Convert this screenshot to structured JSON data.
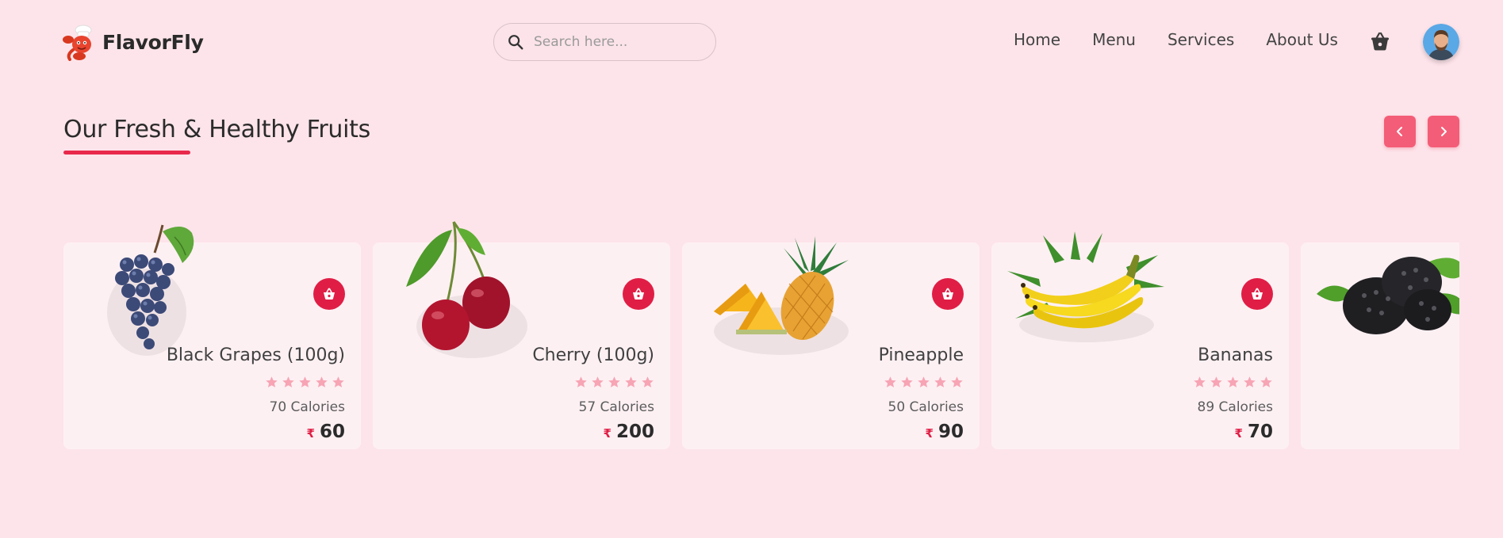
{
  "brand": {
    "name": "FlavorFly"
  },
  "search": {
    "placeholder": "Search here..."
  },
  "nav": {
    "items": [
      "Home",
      "Menu",
      "Services",
      "About Us"
    ]
  },
  "section": {
    "title": "Our Fresh & Healthy Fruits"
  },
  "products": [
    {
      "name": "Black Grapes (100g)",
      "rating": 5,
      "calories": "70 Calories",
      "currency": "₹",
      "price": "60"
    },
    {
      "name": "Cherry (100g)",
      "rating": 5,
      "calories": "57 Calories",
      "currency": "₹",
      "price": "200"
    },
    {
      "name": "Pineapple",
      "rating": 5,
      "calories": "50 Calories",
      "currency": "₹",
      "price": "90"
    },
    {
      "name": "Bananas",
      "rating": 5,
      "calories": "89 Calories",
      "currency": "₹",
      "price": "70"
    }
  ],
  "colors": {
    "background": "#fde4ea",
    "accent": "#e01e45",
    "arrow": "#f45d77",
    "star": "#f7a4b4",
    "card": "#fdf0f3"
  },
  "icons": [
    "chef-logo-icon",
    "search-icon",
    "cart-icon",
    "avatar",
    "chevron-left-icon",
    "chevron-right-icon",
    "basket-icon",
    "star-icon"
  ]
}
